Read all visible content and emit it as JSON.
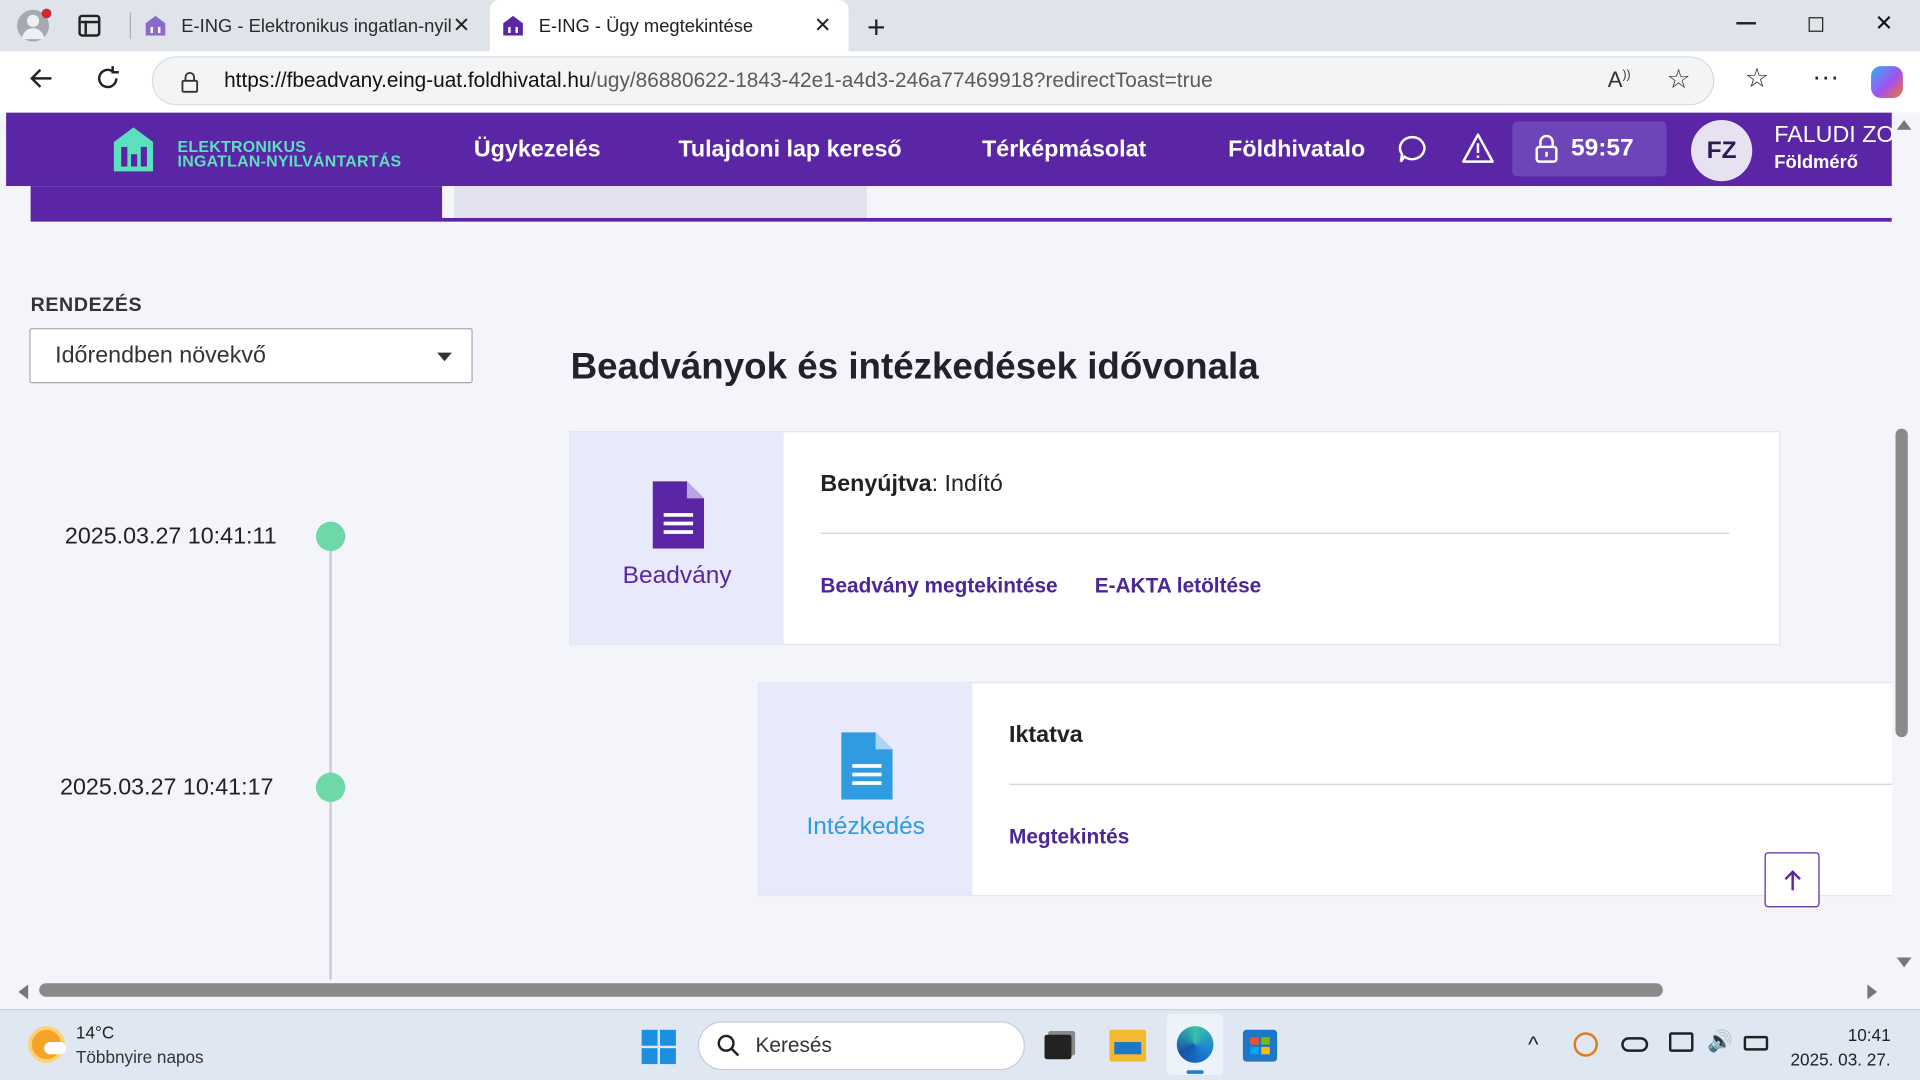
{
  "browser": {
    "tabs": [
      {
        "title": "E-ING - Elektronikus ingatlan-nyil",
        "active": false
      },
      {
        "title": "E-ING - Ügy megtekintése",
        "active": true
      }
    ],
    "url_domain": "https://fbeadvany.eing-uat.foldhivatal.hu",
    "url_path": "/ugy/86880622-1843-42e1-a4d3-246a77469918?redirectToast=true"
  },
  "header": {
    "logo_line1": "ELEKTRONIKUS",
    "logo_line2": "INGATLAN-NYILVÁNTARTÁS",
    "nav": [
      "Ügykezelés",
      "Tulajdoni lap kereső",
      "Térképmásolat",
      "Földhivatalo"
    ],
    "timer": "59:57",
    "avatar_initials": "FZ",
    "user_name": "FALUDI ZO",
    "user_role": "Földmérő"
  },
  "sort": {
    "label": "RENDEZÉS",
    "selected": "Időrendben növekvő"
  },
  "page": {
    "title": "Beadványok és intézkedések idővonala"
  },
  "timeline": [
    {
      "date": "2025.03.27 10:41:11",
      "type_label": "Beadvány",
      "status_bold": "Benyújtva",
      "status_rest": ": Indító",
      "links": [
        "Beadvány megtekintése",
        "E-AKTA letöltése"
      ]
    },
    {
      "date": "2025.03.27 10:41:17",
      "type_label": "Intézkedés",
      "status_bold": "Iktatva",
      "status_rest": "",
      "links": [
        "Megtekintés"
      ]
    }
  ],
  "taskbar": {
    "temperature": "14°C",
    "weather": "Többnyire napos",
    "search_placeholder": "Keresés",
    "time": "10:41",
    "date": "2025. 03. 27."
  },
  "colors": {
    "brand_purple": "#5a26a6",
    "logo_green": "#5ce0bd",
    "timeline_dot": "#6ed8a8",
    "beadvany_icon": "#5a26a6",
    "intezkedes_icon": "#2f9be0"
  }
}
